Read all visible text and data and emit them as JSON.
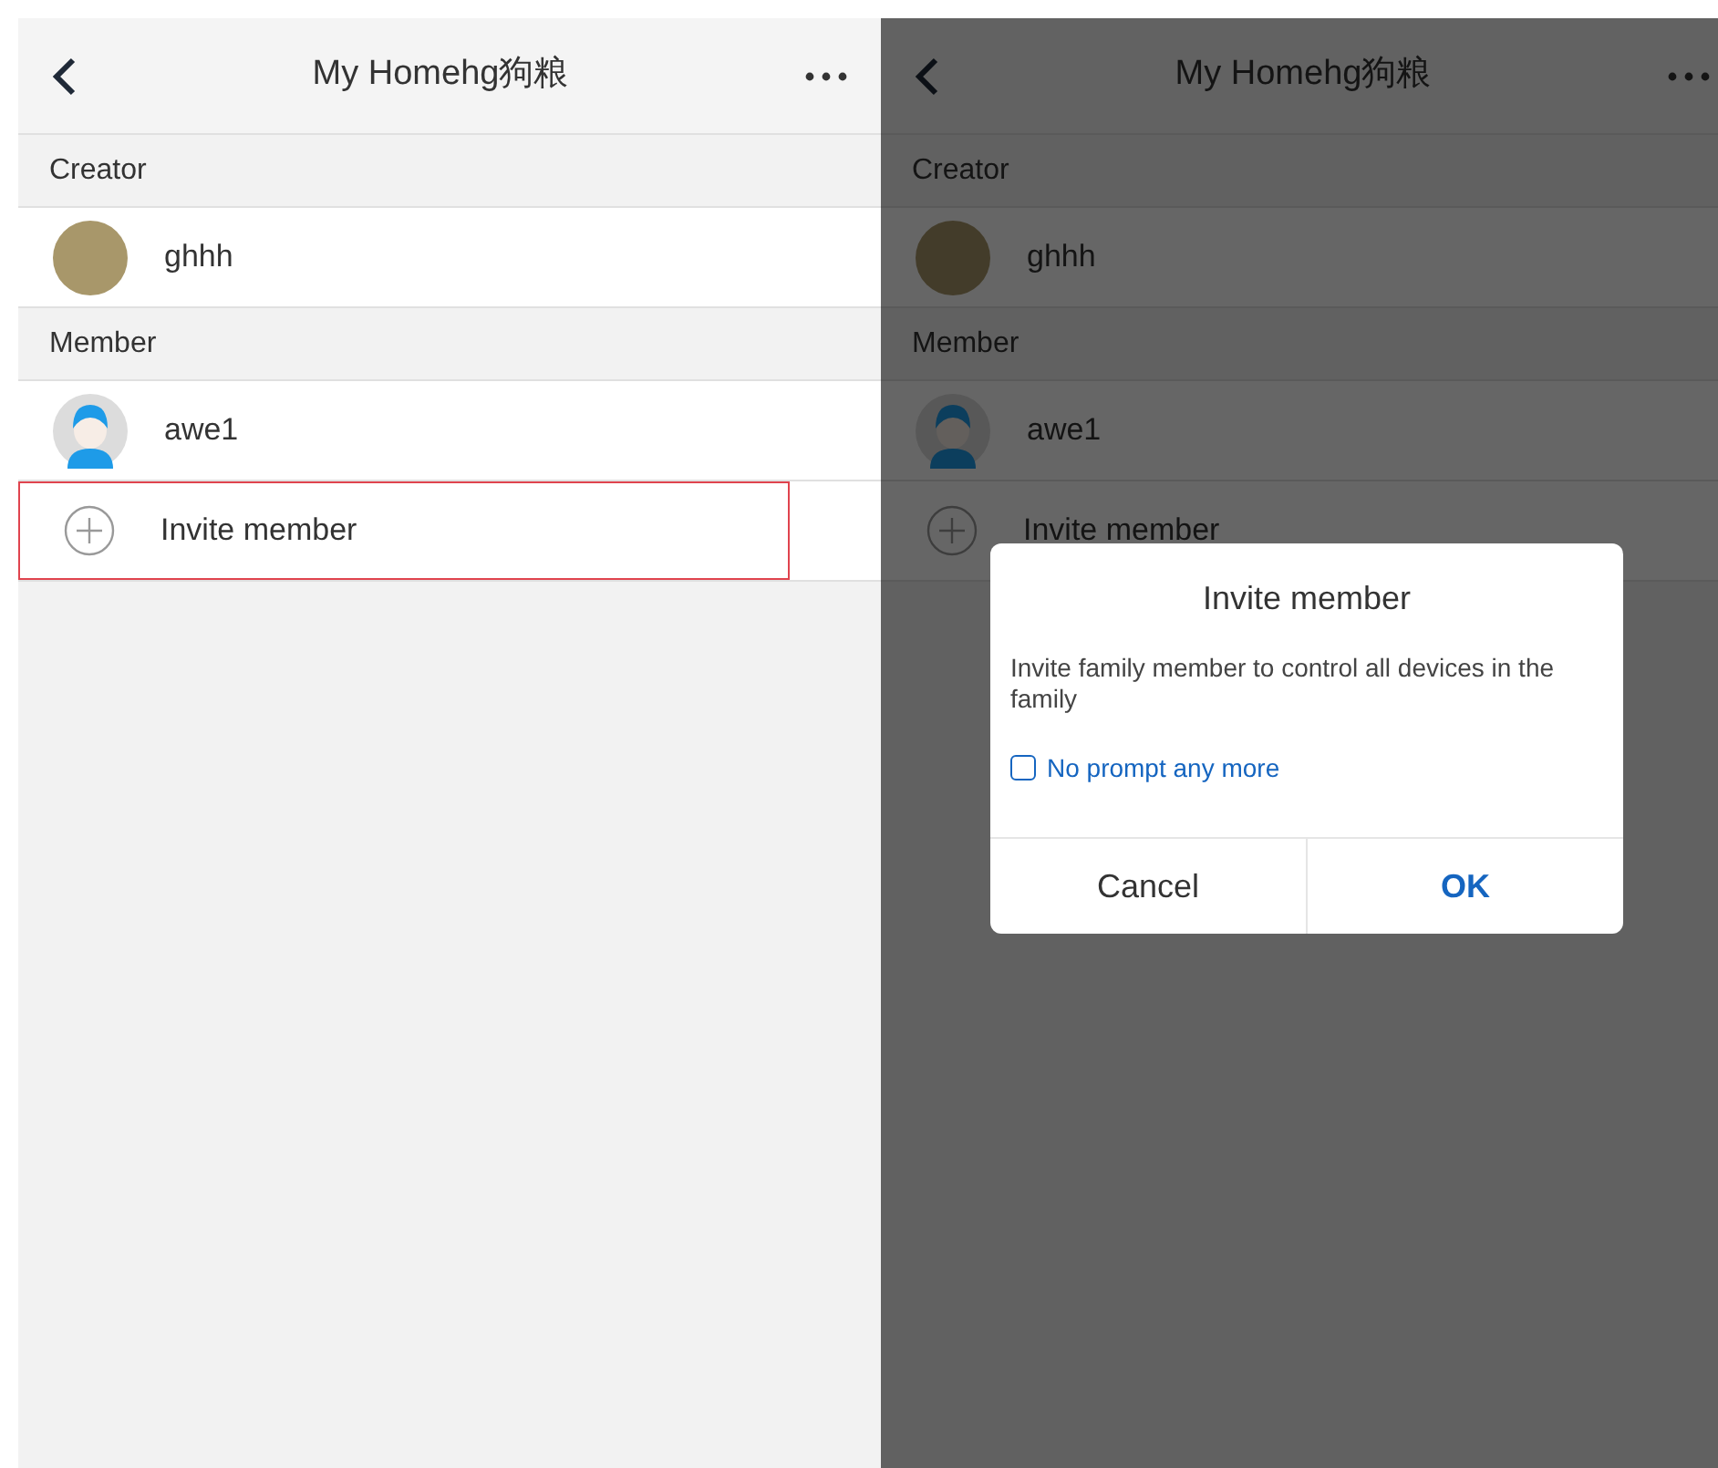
{
  "screens": [
    {
      "dimmed": false,
      "header": {
        "title": "My Homehg狗粮"
      },
      "sections": [
        {
          "label": "Creator",
          "members": [
            {
              "name": "ghhh",
              "kind": "photo"
            }
          ]
        },
        {
          "label": "Member",
          "members": [
            {
              "name": "awe1",
              "kind": "default"
            }
          ]
        }
      ],
      "invite": {
        "label": "Invite member",
        "highlighted": true
      }
    },
    {
      "dimmed": true,
      "header": {
        "title": "My Homehg狗粮"
      },
      "sections": [
        {
          "label": "Creator",
          "members": [
            {
              "name": "ghhh",
              "kind": "photo"
            }
          ]
        },
        {
          "label": "Member",
          "members": [
            {
              "name": "awe1",
              "kind": "default"
            }
          ]
        }
      ],
      "invite": {
        "label": "Invite member",
        "highlighted": false
      },
      "dialog": {
        "title": "Invite member",
        "message": "Invite family member to control all devices in the family",
        "checkbox": {
          "label": "No prompt any more",
          "checked": false
        },
        "buttons": [
          {
            "label": "Cancel",
            "kind": "cancel"
          },
          {
            "label": "OK",
            "kind": "confirm"
          }
        ]
      }
    }
  ]
}
